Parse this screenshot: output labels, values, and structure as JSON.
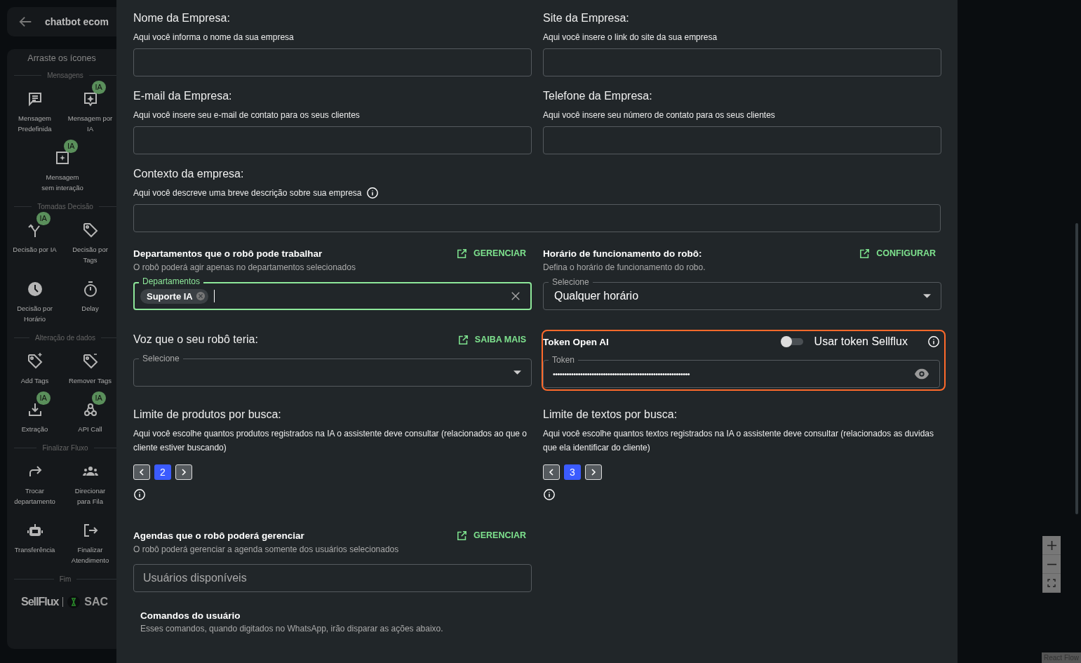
{
  "header": {
    "title": "chatbot ecom"
  },
  "palette": {
    "title": "Arraste os ícones",
    "sections": [
      {
        "title": "Mensagens",
        "items": [
          {
            "label": "Mensagem Predefinida",
            "kind": "message"
          },
          {
            "label": "Mensagem por IA",
            "kind": "ai-message",
            "badge": "IA"
          },
          {
            "label": "Mensagem sem interação",
            "kind": "ai-box",
            "badge": "IA"
          }
        ]
      },
      {
        "title": "Tomadas Decisão",
        "items": [
          {
            "label": "Decisão por IA",
            "kind": "split",
            "badge": "IA"
          },
          {
            "label": "Decisão por Tags",
            "kind": "tag"
          },
          {
            "label": "Decisão por Horário",
            "kind": "clock"
          },
          {
            "label": "Delay",
            "kind": "timer"
          }
        ]
      },
      {
        "title": "Alteração de dados",
        "items": [
          {
            "label": "Add Tags",
            "kind": "tag-plus"
          },
          {
            "label": "Remover Tags",
            "kind": "tag-minus"
          },
          {
            "label": "Extração",
            "kind": "download",
            "badge": "IA"
          },
          {
            "label": "API Call",
            "kind": "webhook",
            "badge": "IA"
          }
        ]
      },
      {
        "title": "Finalizar Fluxo",
        "items": [
          {
            "label": "Trocar departamento",
            "kind": "redo"
          },
          {
            "label": "Direcionar para Fila",
            "kind": "group"
          },
          {
            "label": "Transferência",
            "kind": "robot"
          },
          {
            "label": "Finalizar Atendimento",
            "kind": "exit"
          }
        ]
      },
      {
        "title": "Fim"
      }
    ],
    "brand": {
      "name": "SellFlux",
      "product": "SAC"
    }
  },
  "form": {
    "company_fields": [
      {
        "label": "Nome da Empresa:",
        "hint": "Aqui você informa o nome da sua empresa"
      },
      {
        "label": "Site da Empresa:",
        "hint": "Aqui você insere o link do site da sua empresa"
      },
      {
        "label": "E-mail da Empresa:",
        "hint": "Aqui você insere seu e-mail de contato para os seus clientes"
      },
      {
        "label": "Telefone da Empresa:",
        "hint": "Aqui você insere seu número de contato para os seus clientes"
      }
    ],
    "context": {
      "label": "Contexto da empresa:",
      "hint": "Aqui você descreve uma breve descrição sobre sua empresa"
    },
    "departments": {
      "title": "Departamentos que o robô pode trabalhar",
      "link": "GERENCIAR",
      "description": "O robô poderá agir apenas no departamentos selecionados",
      "legend": "Departamentos",
      "focused": true,
      "chips": [
        "Suporte IA"
      ]
    },
    "schedule": {
      "title": "Horário de funcionamento do robô:",
      "link": "CONFIGURAR",
      "description": "Defina o horário de funcionamento do robo.",
      "legend": "Selecione",
      "value": "Qualquer horário"
    },
    "voice": {
      "title": "Voz que o seu robô teria:",
      "link": "SAIBA MAIS",
      "legend": "Selecione"
    },
    "token": {
      "title": "Token Open AI",
      "toggle_label": "Usar token Sellflux",
      "toggle_on": false,
      "legend": "Token",
      "value": "••••••••••••••••••••••••••••••••••••••••••••••••••••••••••••",
      "highlighted": true
    },
    "limits": [
      {
        "title": "Limite de produtos por busca:",
        "description": "Aqui você escolhe quantos produtos registrados na IA o assistente deve consultar (relacionados ao que o cliente estiver buscando)",
        "value": "2"
      },
      {
        "title": "Limite de textos por busca:",
        "description": "Aqui você escolhe quantos textos registrados na IA o assistente deve consultar (relacionados as duvidas que ela identificar do cliente)",
        "value": "3"
      }
    ],
    "agendas": {
      "title": "Agendas que o robô poderá gerenciar",
      "link": "GERENCIAR",
      "description": "O robô poderá gerenciar a agenda somente dos usuários selecionados",
      "placeholder": "Usuários disponíveis"
    },
    "commands": {
      "title": "Comandos do usuário",
      "description": "Esses comandos, quando digitados no WhatsApp, irão disparar as ações abaixo."
    }
  },
  "canvas": {
    "attribution": "React Flow"
  }
}
